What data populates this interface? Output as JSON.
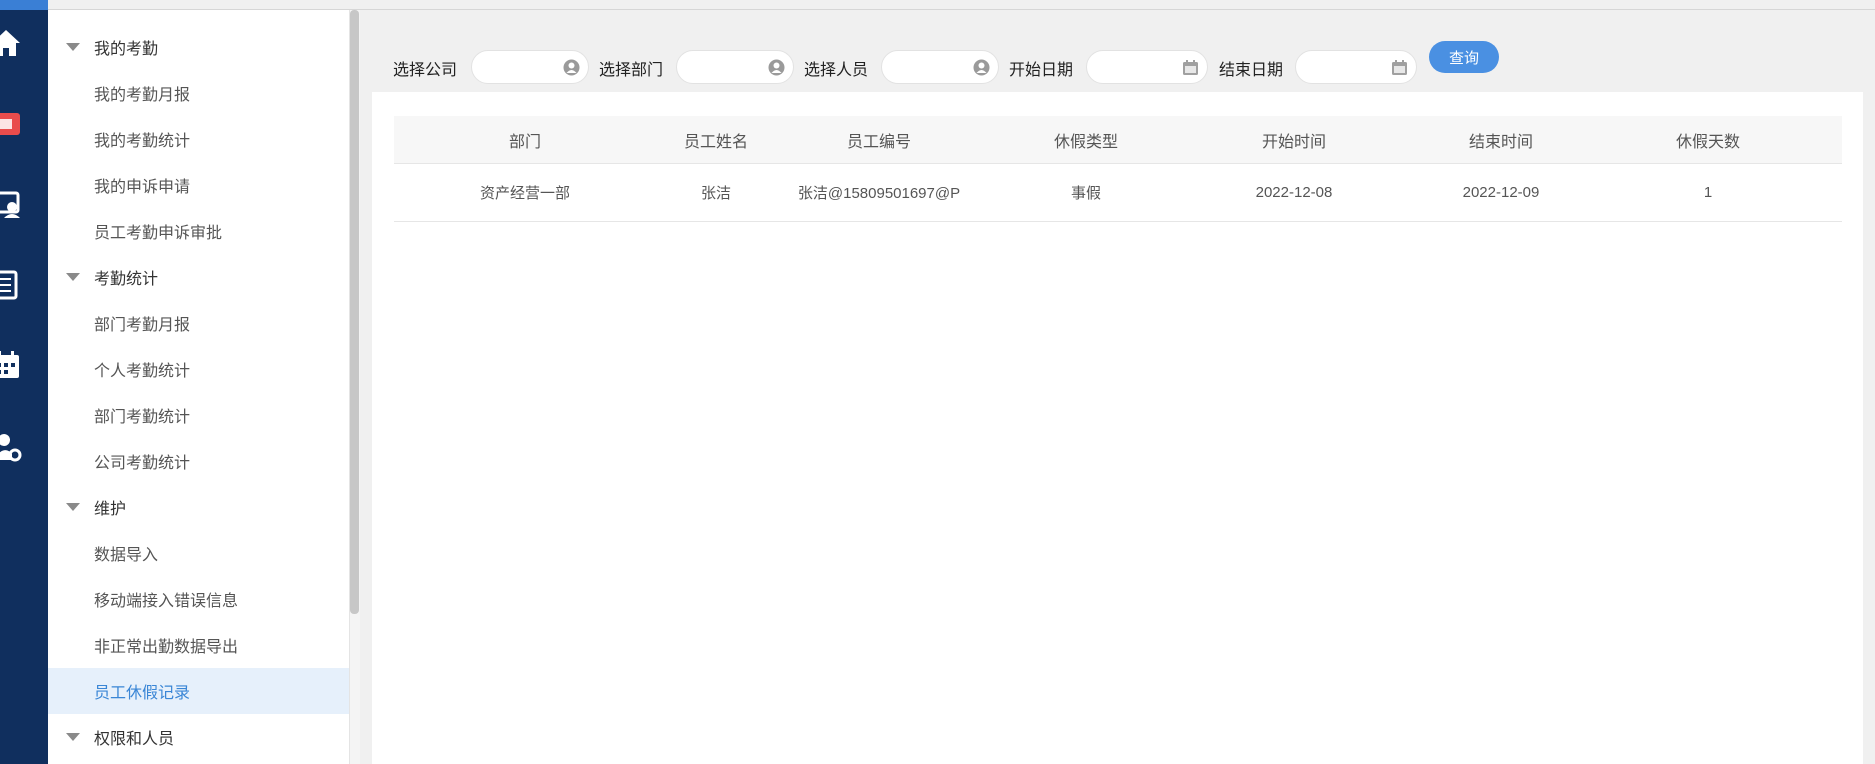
{
  "sidebar": {
    "sections": [
      {
        "title": "我的考勤",
        "items": [
          "我的考勤月报",
          "我的考勤统计",
          "我的申诉申请",
          "员工考勤申诉审批"
        ]
      },
      {
        "title": "考勤统计",
        "items": [
          "部门考勤月报",
          "个人考勤统计",
          "部门考勤统计",
          "公司考勤统计"
        ]
      },
      {
        "title": "维护",
        "items": [
          "数据导入",
          "移动端接入错误信息",
          "非正常出勤数据导出",
          "员工休假记录"
        ]
      },
      {
        "title": "权限和人员",
        "items": []
      }
    ],
    "active_item": "员工休假记录"
  },
  "rail_icons": [
    "home-icon",
    "ticket-icon",
    "monitor-user-icon",
    "document-list-icon",
    "calendar-icon",
    "user-settings-icon"
  ],
  "filters": {
    "company_label": "选择公司",
    "department_label": "选择部门",
    "person_label": "选择人员",
    "start_date_label": "开始日期",
    "end_date_label": "结束日期",
    "query_button": "查询"
  },
  "table": {
    "columns": [
      "部门",
      "员工姓名",
      "员工编号",
      "休假类型",
      "开始时间",
      "结束时间",
      "休假天数"
    ],
    "rows": [
      [
        "资产经营一部",
        "张洁",
        "张洁@15809501697@P",
        "事假",
        "2022-12-08",
        "2022-12-09",
        "1"
      ]
    ]
  },
  "colors": {
    "rail": "#102f5e",
    "accent": "#4a90e2",
    "active_bg": "#e6f0fb",
    "active_text": "#3a86d6"
  }
}
